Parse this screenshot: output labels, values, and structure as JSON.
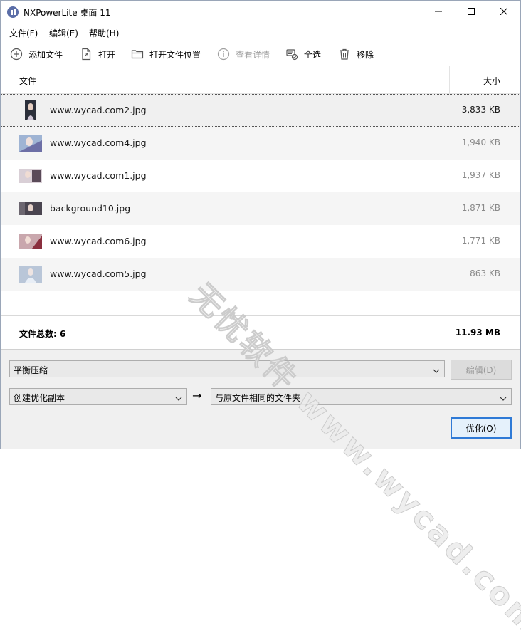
{
  "window": {
    "title": "NXPowerLite 桌面 11"
  },
  "menu": [
    {
      "label": "文件(F)"
    },
    {
      "label": "编辑(E)"
    },
    {
      "label": "帮助(H)"
    }
  ],
  "toolbar": {
    "add": "添加文件",
    "open": "打开",
    "open_location": "打开文件位置",
    "details": "查看详情",
    "select_all": "全选",
    "remove": "移除"
  },
  "list": {
    "header_file": "文件",
    "header_size": "大小",
    "rows": [
      {
        "name": "www.wycad.com2.jpg",
        "size": "3,833 KB"
      },
      {
        "name": "www.wycad.com4.jpg",
        "size": "1,940 KB"
      },
      {
        "name": "www.wycad.com1.jpg",
        "size": "1,937 KB"
      },
      {
        "name": "background10.jpg",
        "size": "1,871 KB"
      },
      {
        "name": "www.wycad.com6.jpg",
        "size": "1,771 KB"
      },
      {
        "name": "www.wycad.com5.jpg",
        "size": "863 KB"
      }
    ],
    "summary_label": "文件总数: 6",
    "summary_total": "11.93 MB"
  },
  "options": {
    "profile": "平衡压缩",
    "edit_button": "编辑(D)",
    "output_mode": "创建优化副本",
    "arrow": "→",
    "destination": "与原文件相同的文件夹",
    "optimize_button": "优化(O)"
  },
  "watermark": "无忧软件 www.wycad.com",
  "colors": {
    "accent": "#2f7ad6",
    "icon": "#555555",
    "disabled": "#a0a0a0"
  }
}
